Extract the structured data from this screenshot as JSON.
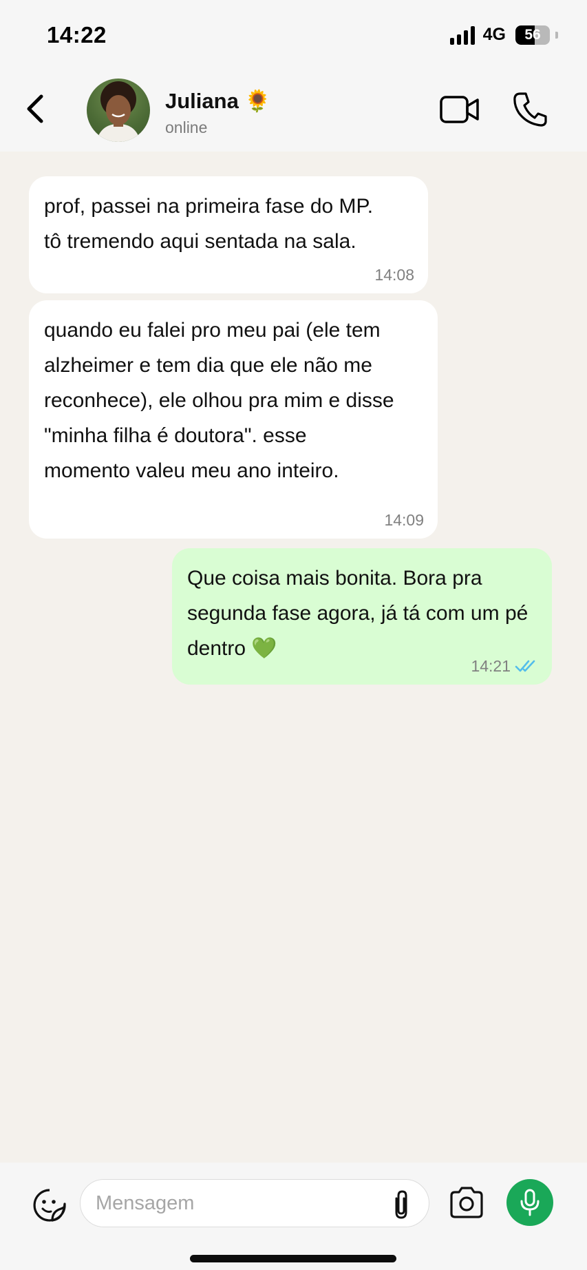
{
  "status_bar": {
    "time": "14:22",
    "network": "4G",
    "battery_level": "56",
    "battery_percent": 56,
    "signal_icon": "signal-bars-icon"
  },
  "header": {
    "back_icon": "chevron-left-icon",
    "contact_name": "Juliana 🌻",
    "contact_status": "online",
    "video_call_icon": "video-camera-icon",
    "voice_call_icon": "phone-icon"
  },
  "messages": [
    {
      "direction": "in",
      "text": "prof, passei na primeira fase do MP.\ntô tremendo aqui sentada na sala.",
      "time": "14:08"
    },
    {
      "direction": "in",
      "text": "quando eu falei pro meu pai (ele tem\nalzheimer e tem dia que ele não me\nreconhece), ele olhou pra mim e disse\n\"minha filha é doutora\". esse\nmomento valeu meu ano inteiro.",
      "time": "14:09"
    },
    {
      "direction": "out",
      "text": "Que coisa mais bonita. Bora pra\nsegunda fase agora, já tá com um pé\ndentro 💚",
      "time": "14:21",
      "status": "read",
      "status_icon": "double-check-icon"
    }
  ],
  "composer": {
    "placeholder": "Mensagem",
    "sticker_icon": "sticker-icon",
    "attach_icon": "paperclip-icon",
    "camera_icon": "camera-icon",
    "mic_icon": "microphone-icon"
  },
  "colors": {
    "outgoing_bubble": "#d9fdd3",
    "incoming_bubble": "#ffffff",
    "chat_background": "#f4f1ec",
    "accent_green": "#1aa858",
    "read_tick": "#53bdeb"
  }
}
